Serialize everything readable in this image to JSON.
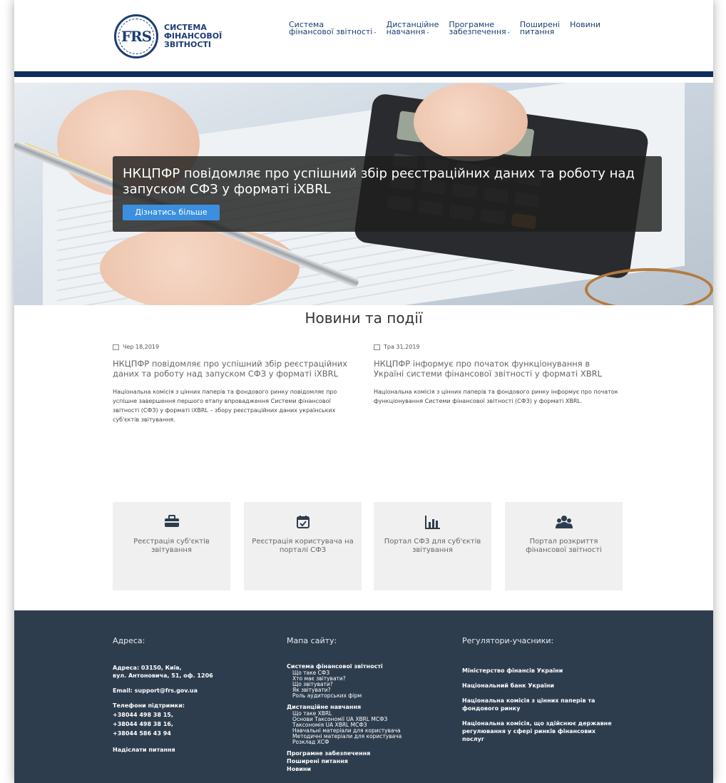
{
  "header": {
    "logo_letters": "FRS",
    "logo_lines": [
      "СИСТЕМА",
      "ФІНАНСОВОЇ",
      "ЗВІТНОСТІ"
    ],
    "nav": [
      {
        "line1": "Система",
        "line2": "фінансової звітності",
        "dropdown": true
      },
      {
        "line1": "Дистанційне",
        "line2": "навчання",
        "dropdown": true
      },
      {
        "line1": "Програмне",
        "line2": "забезпечення",
        "dropdown": true
      },
      {
        "line1": "Поширені",
        "line2": "питання",
        "dropdown": false
      },
      {
        "line1": "Новини",
        "line2": "",
        "dropdown": false
      }
    ]
  },
  "hero": {
    "title": "НКЦПФР повідомляє про успішний збір реєстраційних даних та роботу над запуском СФЗ у форматі iXBRL",
    "button": "Дізнатись більше"
  },
  "news": {
    "heading": "Новини та події",
    "items": [
      {
        "date": "Чер 18,2019",
        "title": "НКЦПФР повідомляє про успішний збір реєстраційних даних та роботу над запуском СФЗ у форматі iXBRL",
        "text": "Національна комісія з цінних паперів та фондового ринку повідомляє про успішне завершення першого етапу впровадження Системи фінансової звітності (СФЗ) у форматі iXBRL – збору реєстраційних даних українських суб'єктів звітування."
      },
      {
        "date": "Тра 31,2019",
        "title": "НКЦПФР інформує про початок функціонування в Україні системи фінансової звітності у форматі XBRL",
        "text": "Національна комісія з цінних паперів та фондового ринку інформує про початок функціонування Системи фінансової звітності (СФЗ) у форматі XBRL."
      }
    ]
  },
  "tiles": [
    {
      "icon": "briefcase-icon",
      "label": "Реєстрація суб'єктів звітування"
    },
    {
      "icon": "calendar-check-icon",
      "label": "Реєстрація користувача на порталі СФЗ"
    },
    {
      "icon": "bar-chart-icon",
      "label": "Портал СФЗ для суб'єктів звітування"
    },
    {
      "icon": "users-icon",
      "label": "Портал розкриття фінансової звітності"
    }
  ],
  "footer": {
    "address": {
      "heading": "Адреса:",
      "address_lines": [
        "Адреса: 03150, Київ,",
        "вул. Антоновича, 51, оф. 1206"
      ],
      "email": "Email: support@frs.gov.ua",
      "phones_label": "Телефони підтримки:",
      "phones": [
        "+38044 498 38 15,",
        "+38044 498 38 16,",
        "+38044 586 43 94"
      ],
      "send_question": "Надіслати питання"
    },
    "sitemap": {
      "heading": "Мапа сайту:",
      "group1_title": "Система фінансової звітності",
      "group1_items": [
        "Що таке СФЗ",
        "Хто має звітувати?",
        "Що звітувати?",
        "Як звітувати?",
        "Роль аудиторських фірм"
      ],
      "group2_title": "Дистанційне навчання",
      "group2_items": [
        "Що таке XBRL",
        "Основи Таксономії UA XBRL МСФЗ",
        "Таксономія UA XBRL МСФЗ",
        "Навчальні матеріали для користувача",
        "Методичні матеріали для користувача",
        "Розклад ХСФ"
      ],
      "tail_items": [
        "Програмне забезпечення",
        "Поширені питання",
        "Новини"
      ]
    },
    "regulators": {
      "heading": "Регулятори-учасники:",
      "items": [
        "Міністерство фінансів України",
        "Національний банк України",
        "Національна комісія з цінних паперів та фондового ринку",
        "Національна комісія, що здійснює державне регулювання у сфері ринків фінансових послуг"
      ]
    }
  }
}
